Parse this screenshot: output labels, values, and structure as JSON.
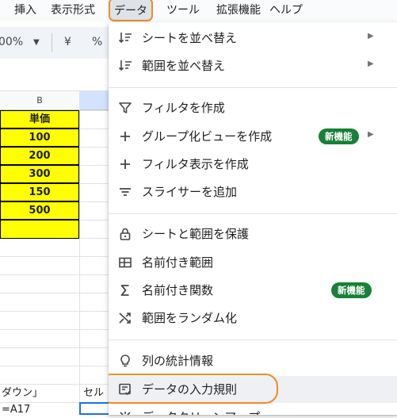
{
  "menubar": {
    "items": [
      "挿入",
      "表示形式",
      "データ",
      "ツール",
      "拡張機能",
      "ヘルプ"
    ],
    "open_item_index": 2
  },
  "toolbar": {
    "zoom": "00%",
    "currency": "¥",
    "percent": "%"
  },
  "sheet": {
    "column_b_label": "B",
    "header_cell": "単価",
    "values": [
      "100",
      "200",
      "300",
      "150",
      "500",
      ""
    ],
    "bottom_left_text_1": "ダウン」",
    "bottom_center_text": "セル",
    "bottom_left_text_2": "=A17"
  },
  "dropdown": {
    "items": [
      {
        "label": "シートを並べ替え",
        "icon": "sort-icon",
        "submenu": true
      },
      {
        "label": "範囲を並べ替え",
        "icon": "sort-icon",
        "submenu": true
      },
      {
        "label": "フィルタを作成",
        "icon": "filter-icon",
        "submenu": false
      },
      {
        "label": "グループ化ビューを作成",
        "icon": "plus-icon",
        "submenu": true,
        "badge": "新機能"
      },
      {
        "label": "フィルタ表示を作成",
        "icon": "plus-icon",
        "submenu": false
      },
      {
        "label": "スライサーを追加",
        "icon": "slicer-icon",
        "submenu": false
      },
      {
        "label": "シートと範囲を保護",
        "icon": "lock-icon",
        "submenu": false
      },
      {
        "label": "名前付き範囲",
        "icon": "named-range-icon",
        "submenu": false
      },
      {
        "label": "名前付き関数",
        "icon": "sigma-icon",
        "submenu": false,
        "badge": "新機能"
      },
      {
        "label": "範囲をランダム化",
        "icon": "shuffle-icon",
        "submenu": false
      },
      {
        "label": "列の統計情報",
        "icon": "lightbulb-icon",
        "submenu": false
      },
      {
        "label": "データの入力規則",
        "icon": "data-validation-icon",
        "submenu": false,
        "highlighted": true
      },
      {
        "label": "データクリーンアップ",
        "icon": "cleanup-icon",
        "submenu": true
      }
    ]
  },
  "colors": {
    "accent_ring": "#f08a28",
    "badge_green": "#188038",
    "cell_yellow": "#ffff00"
  }
}
